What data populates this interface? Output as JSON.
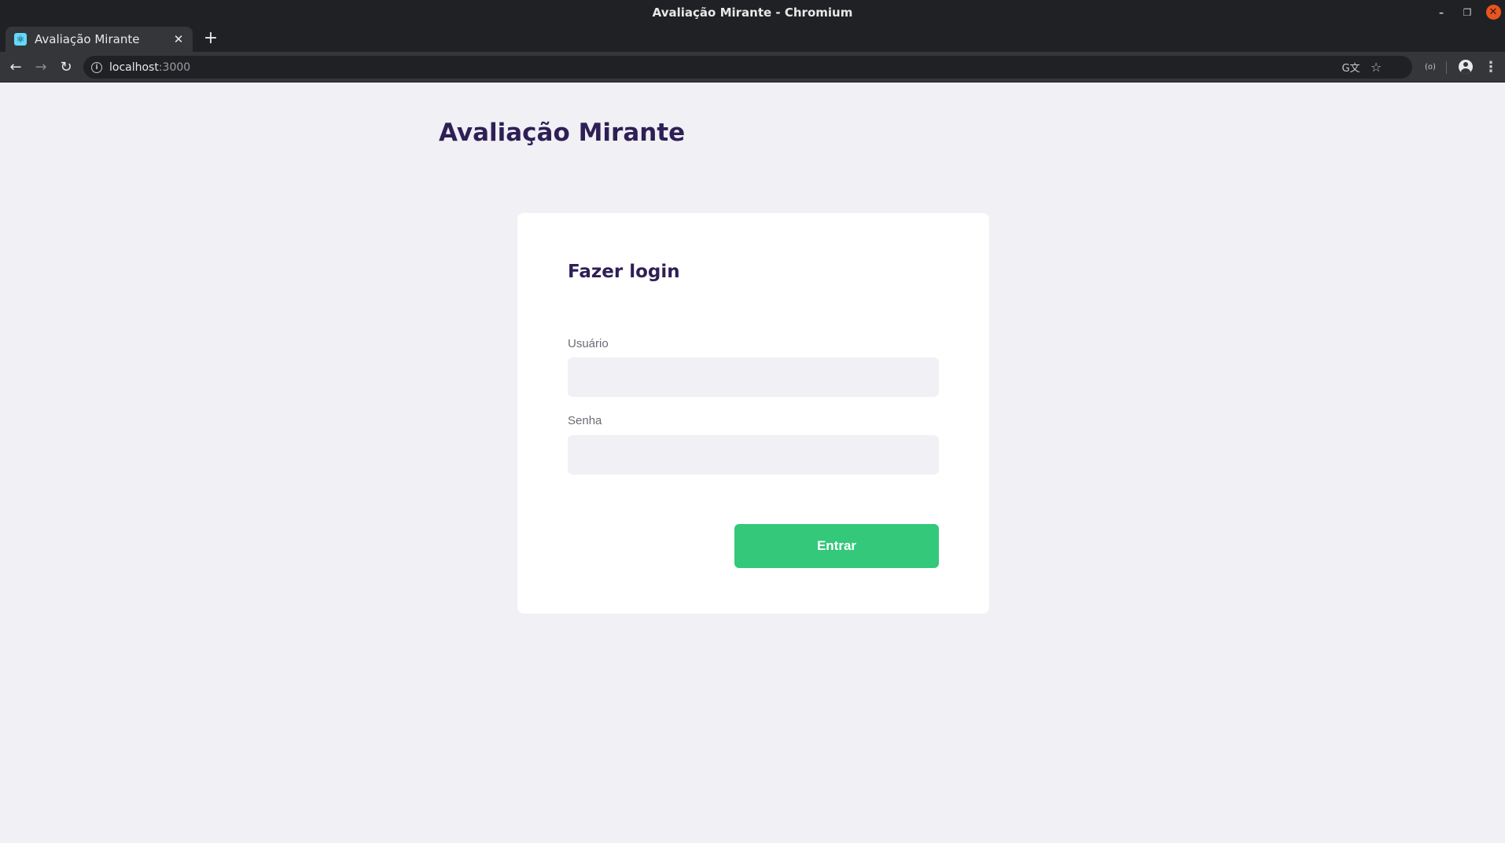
{
  "window": {
    "title": "Avaliação Mirante - Chromium",
    "minimize_glyph": "–",
    "maximize_glyph": "❐",
    "close_glyph": "✕"
  },
  "tabs": [
    {
      "title": "Avaliação Mirante",
      "close_glyph": "✕"
    }
  ],
  "new_tab_glyph": "+",
  "toolbar": {
    "back_glyph": "←",
    "forward_glyph": "→",
    "reload_glyph": "↻",
    "menu_glyph": "⋮",
    "extension_glyph": "(o)"
  },
  "address_bar": {
    "host": "localhost",
    "port": ":3000",
    "info_glyph": "i",
    "translate_glyph": "G文",
    "bookmark_glyph": "☆"
  },
  "page": {
    "app_title": "Avaliação Mirante",
    "login": {
      "heading": "Fazer login",
      "username_label": "Usuário",
      "username_value": "",
      "password_label": "Senha",
      "password_value": "",
      "submit_label": "Entrar"
    }
  },
  "colors": {
    "brand_purple": "#2e1f55",
    "submit_green": "#33c87a",
    "page_background": "#f0f0f5",
    "card_background": "#ffffff"
  }
}
